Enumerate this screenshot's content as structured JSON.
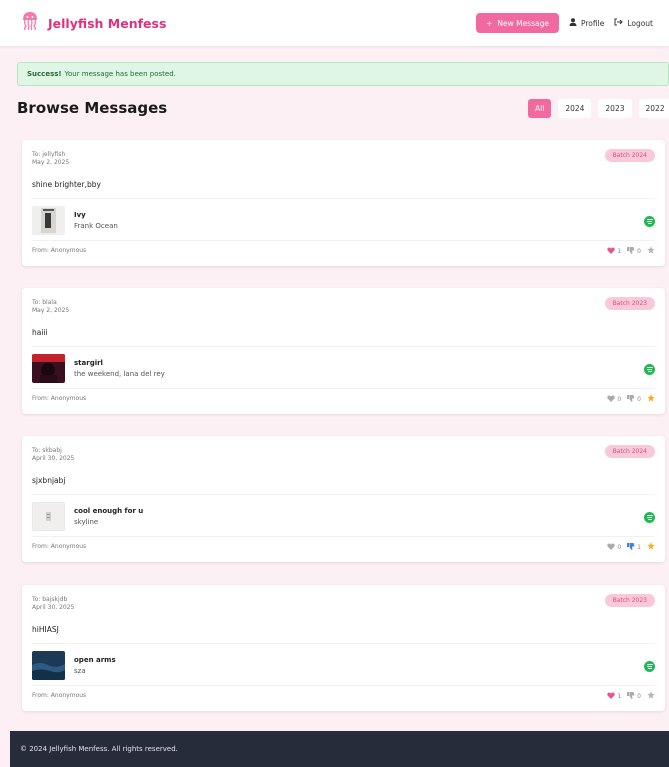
{
  "navbar": {
    "brand": "Jellyfish Menfess",
    "new_message": "New Message",
    "profile": "Profile",
    "logout": "Logout"
  },
  "alert": {
    "strong": "Success!",
    "text": "Your message has been posted."
  },
  "page_title": "Browse Messages",
  "filters": [
    {
      "label": "All",
      "active": true
    },
    {
      "label": "2024",
      "active": false
    },
    {
      "label": "2023",
      "active": false
    },
    {
      "label": "2022",
      "active": false
    }
  ],
  "messages": [
    {
      "to": "To: jellyfish",
      "date": "May 2, 2025",
      "batch": "Batch 2024",
      "text": "shine brighter,bby",
      "song_title": "Ivy",
      "song_artist": "Frank Ocean",
      "from": "From: Anonymous",
      "likes": "1",
      "dislikes": "0"
    },
    {
      "to": "To: blala",
      "date": "May 2, 2025",
      "batch": "Batch 2023",
      "text": "haiii",
      "song_title": "stargirl",
      "song_artist": "the weekend, lana del rey",
      "from": "From: Anonymous",
      "likes": "0",
      "dislikes": "0"
    },
    {
      "to": "To: skbabj",
      "date": "April 30, 2025",
      "batch": "Batch 2024",
      "text": "sjxbnjabj",
      "song_title": "cool enough for u",
      "song_artist": "skyline",
      "from": "From: Anonymous",
      "likes": "0",
      "dislikes": "1"
    },
    {
      "to": "To: bajskjdb",
      "date": "April 30, 2025",
      "batch": "Batch 2023",
      "text": "hiHIASJ",
      "song_title": "open arms",
      "song_artist": "sza",
      "from": "From: Anonymous",
      "likes": "1",
      "dislikes": "0"
    }
  ],
  "footer": "© 2024 Jellyfish Menfess. All rights reserved.",
  "colors": {
    "brand_pink": "#e0317e",
    "button_pink": "#f06aa0",
    "background": "#fdf0f5",
    "spotify_green": "#1db954",
    "footer_bg": "#262c3a"
  }
}
